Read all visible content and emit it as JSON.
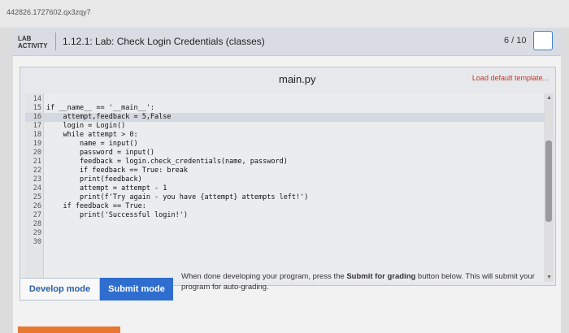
{
  "topstrip": {
    "id_text": "442826.1727602.qx3zqy7"
  },
  "header": {
    "lab_line1": "LAB",
    "lab_line2": "ACTIVITY",
    "title": "1.12.1: Lab: Check Login Credentials (classes)",
    "score": "6 / 10"
  },
  "editor": {
    "filename": "main.py",
    "load_template": "Load default template...",
    "lines": [
      {
        "n": "14",
        "t": ""
      },
      {
        "n": "15",
        "t": "if __name__ == '__main__':"
      },
      {
        "n": "16",
        "t": "    attempt,feedback = 5,False"
      },
      {
        "n": "17",
        "t": "    login = Login()"
      },
      {
        "n": "18",
        "t": "    while attempt > 0:"
      },
      {
        "n": "19",
        "t": "        name = input()"
      },
      {
        "n": "20",
        "t": "        password = input()"
      },
      {
        "n": "21",
        "t": "        feedback = login.check_credentials(name, password)"
      },
      {
        "n": "22",
        "t": "        if feedback == True: break"
      },
      {
        "n": "23",
        "t": "        print(feedback)"
      },
      {
        "n": "24",
        "t": "        attempt = attempt - 1"
      },
      {
        "n": "25",
        "t": "        print(f'Try again - you have {attempt} attempts left!')"
      },
      {
        "n": "26",
        "t": "    if feedback == True:"
      },
      {
        "n": "27",
        "t": "        print('Successful login!')"
      },
      {
        "n": "28",
        "t": ""
      },
      {
        "n": "29",
        "t": ""
      },
      {
        "n": "30",
        "t": ""
      }
    ]
  },
  "actions": {
    "develop_mode": "Develop mode",
    "submit_mode": "Submit mode",
    "info_before": "When done developing your program, press the ",
    "info_bold": "Submit for grading",
    "info_after": " button below. This will submit your program for auto-grading."
  },
  "colors": {
    "accent": "#2f6ecf",
    "link_red": "#c0392b",
    "orange": "#e9782f"
  }
}
